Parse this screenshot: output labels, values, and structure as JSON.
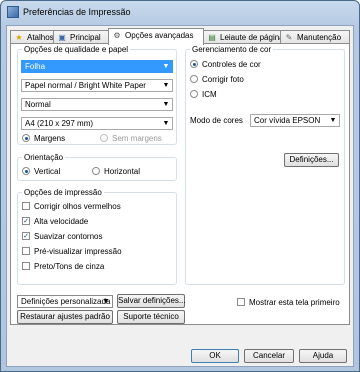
{
  "window": {
    "title": "Preferências de Impressão",
    "title_icon": "printer-icon"
  },
  "tabs": [
    {
      "label": "Atalhos",
      "icon": "shortcut-star-icon",
      "glyph": "★",
      "color": "#d9a300"
    },
    {
      "label": "Principal",
      "icon": "printer-icon",
      "glyph": "▣",
      "color": "#3a6aa8"
    },
    {
      "label": "Opções avançadas",
      "icon": "settings-gear-icon",
      "glyph": "⚙",
      "color": "#555555",
      "active": true
    },
    {
      "label": "Leiaute de página",
      "icon": "page-layout-icon",
      "glyph": "▤",
      "color": "#2f7a2f"
    },
    {
      "label": "Manutenção",
      "icon": "maintenance-wrench-icon",
      "glyph": "✎",
      "color": "#666666"
    }
  ],
  "quality": {
    "group_label": "Opções de qualidade e papel",
    "paper_source": "Folha",
    "paper_type": "Papel normal / Bright White Paper",
    "quality": "Normal",
    "paper_size": "A4 (210 x 297 mm)",
    "margins_label": "Margens",
    "no_margins_label": "Sem margens"
  },
  "orientation": {
    "group_label": "Orientação",
    "portrait": "Vertical",
    "landscape": "Horizontal"
  },
  "print_options": {
    "group_label": "Opções de impressão",
    "items": [
      {
        "label": "Corrigir olhos vermelhos",
        "checked": false
      },
      {
        "label": "Alta velocidade",
        "checked": true
      },
      {
        "label": "Suavizar contornos",
        "checked": true
      },
      {
        "label": "Pré-visualizar impressão",
        "checked": false
      },
      {
        "label": "Preto/Tons de cinza",
        "checked": false
      }
    ]
  },
  "color_management": {
    "group_label": "Gerenciamento de cor",
    "option1": "Controles de cor",
    "option2": "Corrigir foto",
    "option3": "ICM",
    "mode_label": "Modo de cores",
    "mode_value": "Cor vívida EPSON",
    "settings_button": "Definições..."
  },
  "bottom": {
    "custom_settings": "Definições personalizada",
    "save_settings": "Salvar definições...",
    "restore_defaults": "Restaurar ajustes padrão",
    "tech_support": "Suporte técnico",
    "show_first": "Mostrar esta tela primeiro"
  },
  "dialog_buttons": {
    "ok": "OK",
    "cancel": "Cancelar",
    "help": "Ajuda"
  }
}
